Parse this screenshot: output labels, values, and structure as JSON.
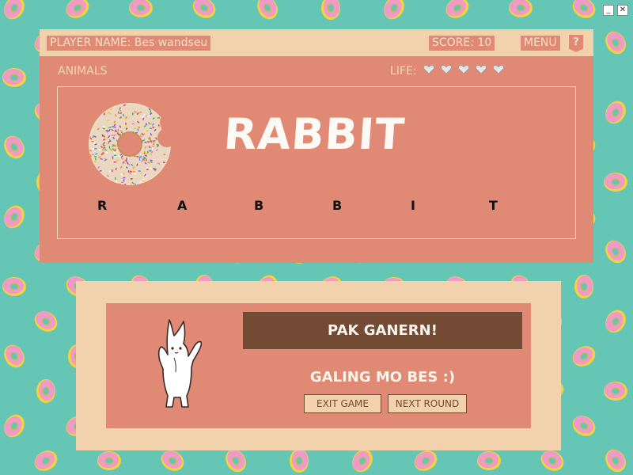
{
  "window": {
    "minimize_glyph": "_",
    "close_glyph": "✕"
  },
  "top_bar": {
    "player_name": "PLAYER NAME: Bes wandseu",
    "score": "SCORE: 10",
    "menu": "MENU",
    "help": "?"
  },
  "game": {
    "category": "ANIMALS",
    "life_label": "LIFE:",
    "lives": 5,
    "word": "RABBIT",
    "letters": [
      "R",
      "A",
      "B",
      "B",
      "I",
      "T"
    ]
  },
  "result": {
    "banner": "PAK GANERN!",
    "message": "GALING MO BES :)",
    "exit_label": "EXIT GAME",
    "next_label": "NEXT ROUND"
  },
  "icons": {
    "life": "heart-icon",
    "background": "donut-pattern",
    "mascot": "bunny-icon"
  },
  "colors": {
    "background": "#66c6b6",
    "panel": "#e08a75",
    "panel_light": "#f1d2ad",
    "banner": "#734a34"
  }
}
